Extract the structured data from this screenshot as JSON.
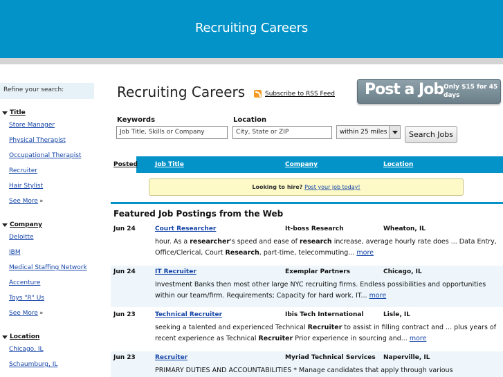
{
  "header": {
    "title": "Recruiting Careers"
  },
  "sidebar": {
    "refine_label": "Refine your search:",
    "groups": [
      {
        "title": "Title",
        "items": [
          "Store Manager",
          "Physical Therapist",
          "Occupational Therapist",
          "Recruiter",
          "Hair Stylist"
        ],
        "see_more": "See More",
        "see_more_suffix": "»"
      },
      {
        "title": "Company",
        "items": [
          "Deloitte",
          "IBM",
          "Medical Staffing Network",
          "Accenture",
          "Toys \"R\" Us"
        ],
        "see_more": "See More",
        "see_more_suffix": "»"
      },
      {
        "title": "Location",
        "items": [
          "Chicago, IL",
          "Schaumburg, IL"
        ]
      }
    ]
  },
  "main": {
    "title": "Recruiting Careers",
    "rss_label": "Subscribe to RSS Feed",
    "post_job": {
      "big": "Post a Job",
      "small": "Only $15 for 45 days"
    }
  },
  "search": {
    "keywords_label": "Keywords",
    "keywords_value": "Job Title, Skills or Company",
    "location_label": "Location",
    "location_value": "City, State or ZIP",
    "radius": "within 25 miles",
    "button": "Search Jobs"
  },
  "table": {
    "headers": {
      "posted": "Posted",
      "title": "Job Title",
      "company": "Company",
      "location": "Location"
    }
  },
  "hire_banner": {
    "text": "Looking to hire?",
    "link": "Post your job today!"
  },
  "featured_title": "Featured Job Postings from the Web",
  "jobs": [
    {
      "date": "Jun 24",
      "title": "Court Researcher",
      "company": "It-boss Research",
      "location": "Wheaton, IL",
      "desc_html": "hour. As a <b>researcher</b>'s speed and ease of <b>research</b> increase, average hourly rate does ... Data Entry, Office/Clerical, Court <b>Research</b>, part-time, telecommuting...",
      "more": "more"
    },
    {
      "date": "Jun 24",
      "title": "IT Recruiter",
      "company": "Exemplar Partners",
      "location": "Chicago, IL",
      "desc_html": "Investment Banks then most other large NYC recruiting firms. Endless possibilities and opportunities within our team/firm. Requirements; Capacity for hard work. IT...",
      "more": "more"
    },
    {
      "date": "Jun 23",
      "title": "Technical Recruiter",
      "company": "Ibis Tech International",
      "location": "Lisle, IL",
      "desc_html": "seeking a talented and experienced Technical <b>Recruiter</b> to assist in filling contract and ... plus years of recent experience as Technical <b>Recruiter</b> Prior experience in sourcing and...",
      "more": "more"
    },
    {
      "date": "Jun 23",
      "title": "Recruiter",
      "company": "Myriad Technical Services",
      "location": "Naperville, IL",
      "desc_html": "PRIMARY DUTIES AND ACCOUNTABILITIES * Manage candidates that apply through various",
      "more": ""
    }
  ]
}
